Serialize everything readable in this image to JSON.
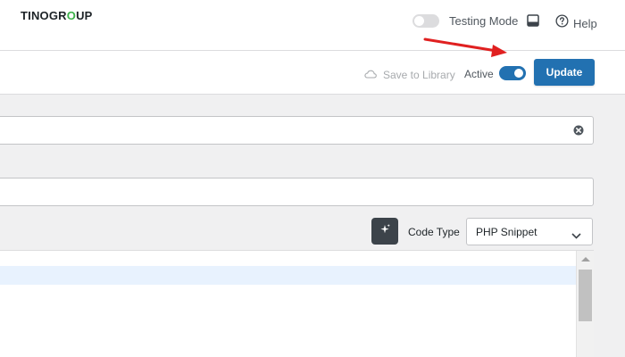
{
  "header": {
    "logo": {
      "part1": "TINO",
      "part2": "GR",
      "part3": "O",
      "part4": "UP"
    },
    "testing_mode_label": "Testing Mode",
    "help_label": "Help"
  },
  "actionbar": {
    "save_to_library_label": "Save to Library",
    "active_label": "Active",
    "active_toggle_on": true,
    "update_label": "Update"
  },
  "title_field": {
    "value": ""
  },
  "description_field": {
    "value": ""
  },
  "code": {
    "type_label": "Code Type",
    "type_value": "PHP Snippet"
  },
  "colors": {
    "primary": "#2271b1",
    "logo_accent": "#3db24b",
    "annotation_arrow": "#e02020"
  },
  "icons": [
    "layout-panel-icon",
    "help-circle-icon",
    "cloud-icon",
    "clear-circle-icon",
    "sparkle-icon",
    "chevron-down-icon"
  ]
}
